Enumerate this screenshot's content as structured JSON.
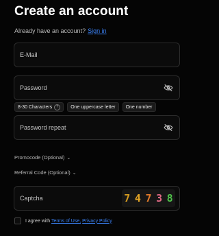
{
  "title": "Create an account",
  "signin": {
    "prompt": "Already have an account?",
    "link": "Sign in"
  },
  "fields": {
    "email": {
      "placeholder": "E-Mail"
    },
    "password": {
      "placeholder": "Password"
    },
    "password_repeat": {
      "placeholder": "Password repeat"
    },
    "captcha": {
      "placeholder": "Captcha"
    }
  },
  "password_hints": [
    "8-30 Characters",
    "One uppercase letter",
    "One number"
  ],
  "promocode": {
    "label": "Promocode (Optional)"
  },
  "referral": {
    "label": "Referral Code (Optional)"
  },
  "captcha_image": {
    "digits": [
      "7",
      "4",
      "7",
      "3",
      "8"
    ],
    "colors": [
      "#d39a1f",
      "#e2a425",
      "#e07a2a",
      "#e06a85",
      "#4fc24a"
    ]
  },
  "agree": {
    "prefix": "I agree with",
    "terms": "Terms of Use,",
    "privacy": "Privacy Policy"
  },
  "colors": {
    "accent": "#3b82f6",
    "background": "#050505"
  },
  "icons": {
    "eye_off": "eye-off-icon",
    "chevron_down": "chevron-down-icon",
    "help": "question-icon"
  }
}
